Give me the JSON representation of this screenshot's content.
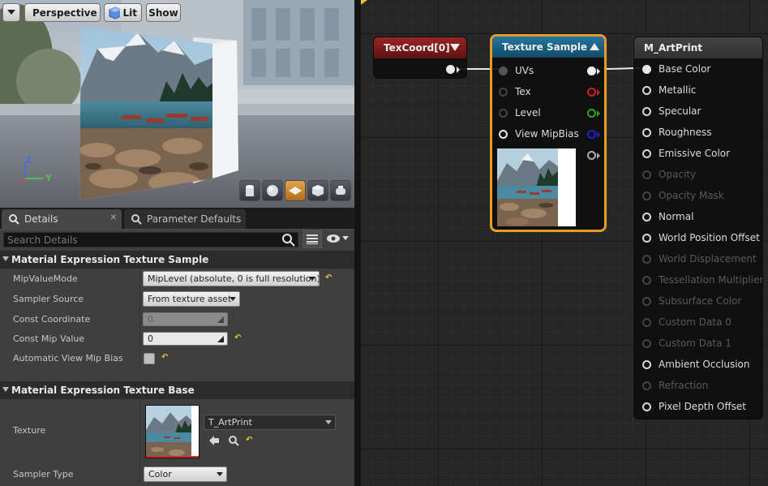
{
  "viewport": {
    "perspective_label": "Perspective",
    "lit_label": "Lit",
    "show_label": "Show",
    "axis_z": "Z",
    "axis_y": "Y"
  },
  "details": {
    "tabs": [
      {
        "label": "Details"
      },
      {
        "label": "Parameter Defaults"
      }
    ],
    "search_placeholder": "Search Details",
    "sections": [
      {
        "title": "Material Expression Texture Sample",
        "properties": [
          {
            "label": "MipValueMode",
            "value": "MipLevel (absolute, 0 is full resolution)"
          },
          {
            "label": "Sampler Source",
            "value": "From texture asset"
          },
          {
            "label": "Const Coordinate",
            "value": "0"
          },
          {
            "label": "Const Mip Value",
            "value": "0"
          },
          {
            "label": "Automatic View Mip Bias",
            "value": ""
          }
        ]
      },
      {
        "title": "Material Expression Texture Base",
        "properties": [
          {
            "label": "Texture",
            "value": "T_ArtPrint"
          },
          {
            "label": "Sampler Type",
            "value": "Color"
          }
        ]
      }
    ]
  },
  "graph": {
    "texcoord_node": {
      "title": "TexCoord[0]",
      "color": "#7a1a1a"
    },
    "texture_sample_node": {
      "title": "Texture Sample",
      "header_color": "#1b5a7a",
      "selection_color": "#e89a2a",
      "inputs": [
        {
          "label": "UVs"
        },
        {
          "label": "Tex"
        },
        {
          "label": "Level"
        },
        {
          "label": "View MipBias"
        }
      ],
      "output_colors": [
        "#ffffff",
        "#cc2222",
        "#22aa22",
        "#2222cc",
        "#aaaaaa"
      ]
    },
    "material_node": {
      "title": "M_ArtPrint",
      "header_color": "#3a3a3a",
      "pins": [
        {
          "label": "Base Color",
          "enabled": true
        },
        {
          "label": "Metallic",
          "enabled": true
        },
        {
          "label": "Specular",
          "enabled": true
        },
        {
          "label": "Roughness",
          "enabled": true
        },
        {
          "label": "Emissive Color",
          "enabled": true
        },
        {
          "label": "Opacity",
          "enabled": false
        },
        {
          "label": "Opacity Mask",
          "enabled": false
        },
        {
          "label": "Normal",
          "enabled": true
        },
        {
          "label": "World Position Offset",
          "enabled": true
        },
        {
          "label": "World Displacement",
          "enabled": false
        },
        {
          "label": "Tessellation Multiplier",
          "enabled": false
        },
        {
          "label": "Subsurface Color",
          "enabled": false
        },
        {
          "label": "Custom Data 0",
          "enabled": false
        },
        {
          "label": "Custom Data 1",
          "enabled": false
        },
        {
          "label": "Ambient Occlusion",
          "enabled": true
        },
        {
          "label": "Refraction",
          "enabled": false
        },
        {
          "label": "Pixel Depth Offset",
          "enabled": true
        }
      ]
    }
  }
}
